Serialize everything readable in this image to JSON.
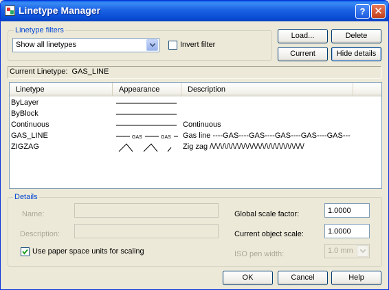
{
  "window": {
    "title": "Linetype Manager",
    "help_button": "?",
    "close_button": "✕"
  },
  "filters": {
    "legend": "Linetype filters",
    "selected": "Show all linetypes",
    "invert_label": "Invert filter",
    "invert_checked": false
  },
  "buttons": {
    "load": "Load...",
    "delete": "Delete",
    "current": "Current",
    "hide_details": "Hide details",
    "ok": "OK",
    "cancel": "Cancel",
    "help": "Help"
  },
  "current_linetype": {
    "label": "Current Linetype:",
    "value": "GAS_LINE"
  },
  "list": {
    "columns": [
      "Linetype",
      "Appearance",
      "Description"
    ],
    "rows": [
      {
        "name": "ByLayer",
        "appearance": "solid",
        "description": ""
      },
      {
        "name": "ByBlock",
        "appearance": "solid",
        "description": ""
      },
      {
        "name": "Continuous",
        "appearance": "solid",
        "description": "Continuous"
      },
      {
        "name": "GAS_LINE",
        "appearance": "gas",
        "description": "Gas line ----GAS----GAS----GAS----GAS----GAS---"
      },
      {
        "name": "ZIGZAG",
        "appearance": "zigzag",
        "description": "Zig zag /\\/\\/\\/\\/\\/\\/\\/\\/\\/\\/\\/\\/\\/\\/\\/\\/\\/\\/\\/\\/\\/\\/"
      }
    ],
    "gas_text": "GAS"
  },
  "details": {
    "legend": "Details",
    "name_label": "Name:",
    "name_value": "",
    "description_label": "Description:",
    "description_value": "",
    "paper_space_label": "Use paper space units for scaling",
    "paper_space_checked": true,
    "global_scale_label": "Global scale factor:",
    "global_scale_value": "1.0000",
    "object_scale_label": "Current object scale:",
    "object_scale_value": "1.0000",
    "iso_pen_label": "ISO pen width:",
    "iso_pen_value": "1.0 mm"
  }
}
